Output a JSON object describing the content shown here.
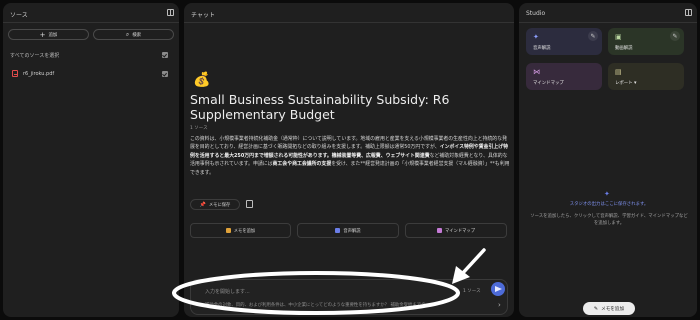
{
  "sources": {
    "title": "ソース",
    "add_label": "追加",
    "search_label": "検索",
    "select_all_label": "すべてのソースを選択",
    "file_name": "r6_jiroku.pdf"
  },
  "chat": {
    "title": "チャット",
    "emoji": "💰",
    "notebook_title": "Small Business Sustainability Subsidy: R6 Supplementary Budget",
    "source_count": "1 ソース",
    "summary": {
      "s1": "この資料は、小規模事業者持続化補助金（通常枠）について説明しています。地域の雇用と産業を支える小規模事業者の生産性向上と持続的な発展を目的としており、経営計画に基づく販路開拓などの取り組みを支援します。補助上限額は通常50万円ですが、",
      "b1": "インボイス特例や賃金引上げ特例を活用すると最大250万円まで増額される可能性があります。",
      "b2": "機械装置等費、広報費、ウェブサイト関連費",
      "s2": "など補助対象経費となり、具体的な活用事例も示されています。申請には",
      "b3": "商工会や商工会議所の支援",
      "s3": "を受け、また**経営発達計画の「小規模事業者経営支援（マル経融資）」**も利用できます。"
    },
    "save_memo_label": "メモに保存",
    "add_memo_label": "メモを追加",
    "audio_label": "音声解説",
    "mindmap_label": "マインドマップ",
    "input_placeholder": "入力を開始します...",
    "source_chip": "1 ソース",
    "suggestion": "補助金の対象、目的、および利用条件は、中小企業にとってどのような重要性を持ちますか？ 補助金受給までの"
  },
  "studio": {
    "title": "Studio",
    "cards": [
      {
        "label": "音声解説",
        "icon": "audio-icon"
      },
      {
        "label": "動画解説",
        "icon": "video-icon"
      },
      {
        "label": "マインドマップ",
        "icon": "mindmap-icon"
      },
      {
        "label": "レポート",
        "icon": "report-icon"
      }
    ],
    "empty_title": "スタジオの出力はここに保存されます。",
    "empty_body": "ソースを追加したら、クリックして音声解説、学習ガイド、マインドマップなどを追加します。",
    "add_memo_label": "メモを追加"
  },
  "colors": {
    "panel": "#1f1f1f",
    "background": "#0b0b0b",
    "accent_blue": "#4d6bd8",
    "pdf_red": "#e24c4c",
    "audio_card": "#2c2c3e",
    "video_card": "#2b3527",
    "mindmap_card": "#372a3c",
    "report_card": "#2e2e24"
  }
}
